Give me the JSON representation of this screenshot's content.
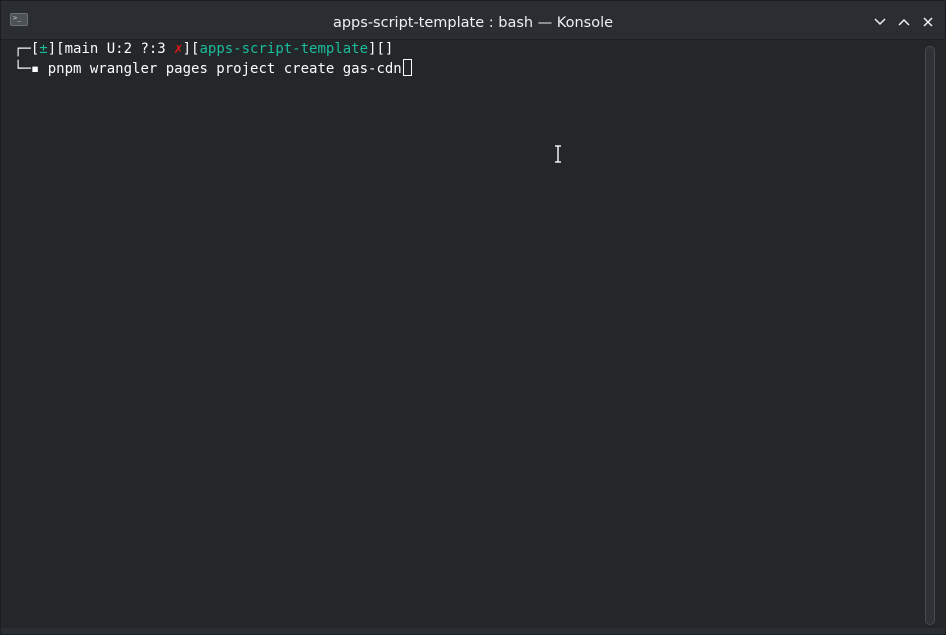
{
  "window": {
    "title": "apps-script-template : bash — Konsole",
    "app_icon_glyph": ">_"
  },
  "titlebar_buttons": [
    {
      "name": "minimize",
      "icon": "chevron-down-icon"
    },
    {
      "name": "maximize",
      "icon": "chevron-up-icon"
    },
    {
      "name": "close",
      "icon": "close-icon"
    }
  ],
  "terminal": {
    "prompt": {
      "corner_top": "┌─",
      "open_bracket_1": "[",
      "vcs_symbol": "±",
      "close_bracket_1": "][",
      "git_status": "main U:2 ?:3 ",
      "git_dirty_mark": "✗",
      "close_bracket_2": "][",
      "directory": "apps-script-template",
      "close_bracket_3": "][]"
    },
    "command_line": {
      "corner_bottom": "└─",
      "marker": "▪",
      "command": " pnpm wrangler pages project create gas-cdn"
    }
  },
  "colors": {
    "background": "#232729",
    "text": "#fcfcfc",
    "accent_green": "#1abc9c",
    "error_red": "#ed1515",
    "titlebar": "#2a2e32"
  }
}
